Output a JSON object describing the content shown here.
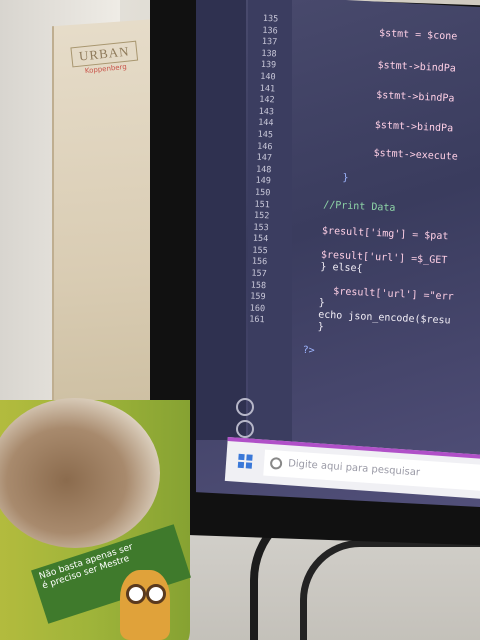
{
  "box": {
    "brand": "URBAN",
    "sub": "Koppenberg"
  },
  "editor": {
    "line_numbers": [
      "135",
      "136",
      "137",
      "138",
      "139",
      "140",
      "141",
      "142",
      "143",
      "144",
      "145",
      "146",
      "147",
      "148",
      "149",
      "150",
      "151",
      "152",
      "153",
      "154",
      "155",
      "156",
      "157",
      "158",
      "159",
      "160",
      "161"
    ],
    "code": {
      "l1": "$stmt = $cone",
      "l2": "$stmt->bindPa",
      "l3": "$stmt->bindPa",
      "l4": "$stmt->bindPa",
      "l5": "$stmt->execute",
      "l6": "}",
      "l7": "//Print Data",
      "l8": "$result['img'] = $pat",
      "l9": "$result['url'] =$_GET",
      "l10": "} else{",
      "l11": "$result['url'] =\"err",
      "l12": "}",
      "l13": "echo json_encode($resu",
      "l14": "}",
      "l15": "?>"
    }
  },
  "taskbar": {
    "search_placeholder": "Digite aqui para pesquisar"
  },
  "mug": {
    "line1": "Não basta apenas ser",
    "line2": "é preciso ser Mestre"
  }
}
